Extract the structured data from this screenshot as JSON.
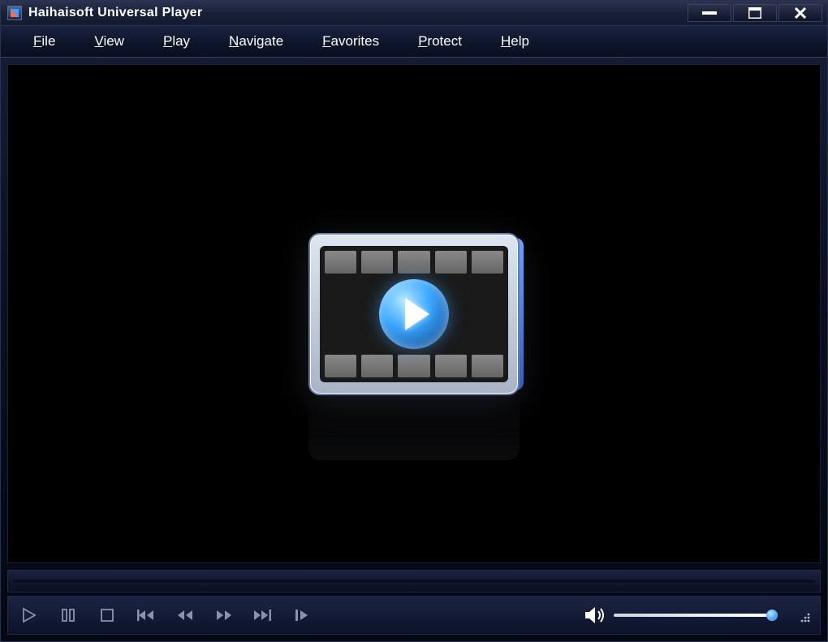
{
  "window": {
    "title": "Haihaisoft Universal Player"
  },
  "menu": {
    "items": [
      {
        "key": "F",
        "rest": "ile"
      },
      {
        "key": "V",
        "rest": "iew"
      },
      {
        "key": "P",
        "rest": "lay"
      },
      {
        "key": "N",
        "rest": "avigate"
      },
      {
        "key": "F",
        "rest": "avorites"
      },
      {
        "key": "P",
        "rest": "rotect"
      },
      {
        "key": "H",
        "rest": "elp"
      }
    ]
  },
  "transport": {
    "buttons": [
      "play",
      "pause",
      "stop",
      "skip-back",
      "rewind",
      "fast-forward",
      "skip-forward",
      "step"
    ]
  },
  "volume": {
    "level": 100
  },
  "colors": {
    "control_icon": "#8a92ac",
    "volume_track": "#d8e0ea",
    "thumb": "#3aa6ff"
  }
}
